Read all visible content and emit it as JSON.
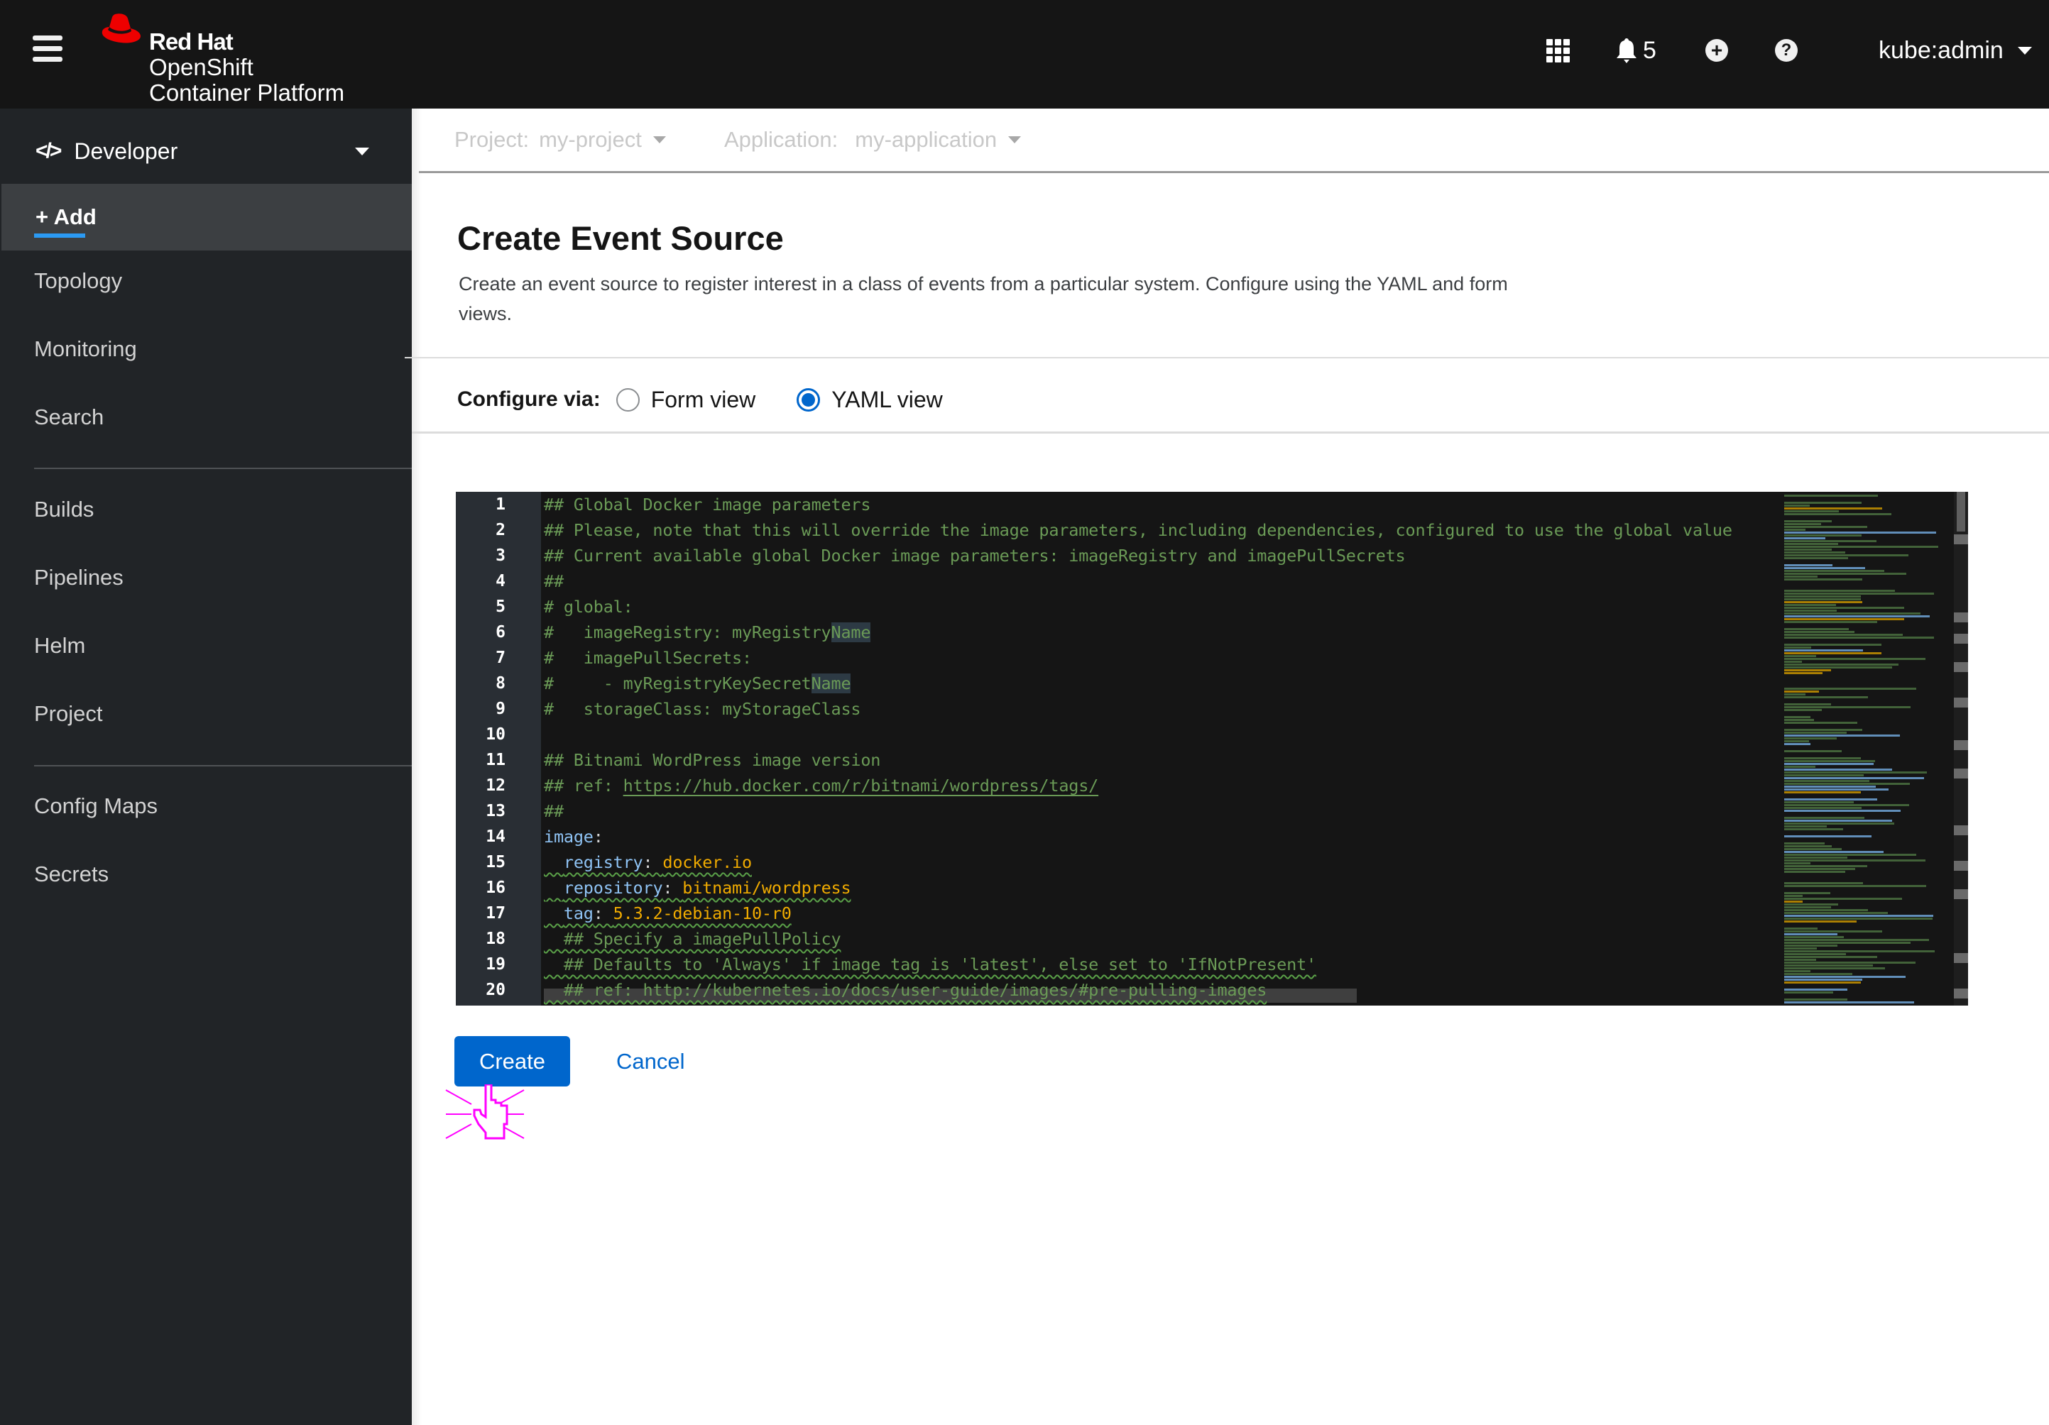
{
  "masthead": {
    "brand_line1": "Red Hat",
    "brand_line2": "OpenShift",
    "brand_line3": "Container Platform",
    "notification_count": "5",
    "user_label": "kube:admin",
    "icons": [
      "hamburger-menu-icon",
      "app-launcher-grid-icon",
      "bell-icon",
      "plus-circle-icon",
      "question-circle-icon",
      "caret-down-icon"
    ]
  },
  "sidebar": {
    "perspective": "Developer",
    "items": [
      {
        "label": "+ Add",
        "active": true
      },
      {
        "label": "Topology"
      },
      {
        "label": "Monitoring"
      },
      {
        "label": "Search"
      },
      {
        "label": "Builds"
      },
      {
        "label": "Pipelines"
      },
      {
        "label": "Helm"
      },
      {
        "label": "Project"
      },
      {
        "label": "Config Maps"
      },
      {
        "label": "Secrets"
      }
    ]
  },
  "context": {
    "project_label": "Project:",
    "project_value": "my-project",
    "application_label": "Application:",
    "application_value": "my-application"
  },
  "page": {
    "title": "Create Event Source",
    "description": "Create an event source to register interest in a class of events from a particular system. Configure using the YAML and form views.",
    "configure_label": "Configure via:",
    "radio_form": "Form view",
    "radio_yaml": "YAML view",
    "selected_view": "YAML view"
  },
  "editor": {
    "line_numbers": [
      "1",
      "2",
      "3",
      "4",
      "5",
      "6",
      "7",
      "8",
      "9",
      "10",
      "11",
      "12",
      "13",
      "14",
      "15",
      "16",
      "17",
      "18",
      "19",
      "20"
    ],
    "lines": {
      "l1": "## Global Docker image parameters",
      "l2": "## Please, note that this will override the image parameters, including dependencies, configured to use the global value",
      "l3": "## Current available global Docker image parameters: imageRegistry and imagePullSecrets",
      "l4": "##",
      "l5": "# global:",
      "l6a": "#   imageRegistry: myRegistry",
      "l6b": "Name",
      "l7": "#   imagePullSecrets:",
      "l8a": "#     - myRegistryKeySecret",
      "l8b": "Name",
      "l9": "#   storageClass: myStorageClass",
      "l10": "",
      "l11": "## Bitnami WordPress image version",
      "l12a": "## ref: ",
      "l12b": "https://hub.docker.com/r/bitnami/wordpress/tags/",
      "l13": "##",
      "l14k": "image",
      "l14p": ":",
      "l15i": "  ",
      "l15k": "registry",
      "l15p": ": ",
      "l15v": "docker.io",
      "l16i": "  ",
      "l16k": "repository",
      "l16p": ": ",
      "l16v": "bitnami/wordpress",
      "l17i": "  ",
      "l17k": "tag",
      "l17p": ": ",
      "l17v": "5.3.2-debian-10-r0",
      "l18": "  ## Specify a imagePullPolicy",
      "l19": "  ## Defaults to 'Always' if image tag is 'latest', else set to 'IfNotPresent'",
      "l20": "  ## ref: http://kubernetes.io/docs/user-guide/images/#pre-pulling-images"
    }
  },
  "actions": {
    "create_label": "Create",
    "cancel_label": "Cancel"
  },
  "colors": {
    "brand_red": "#ee0000",
    "primary_blue": "#0066cc",
    "active_nav_underline": "#2b9af3",
    "yaml_comment": "#6a9a56",
    "yaml_key": "#8fc3f4",
    "yaml_value": "#f0ab00",
    "click_indicator": "#ff00ff"
  }
}
